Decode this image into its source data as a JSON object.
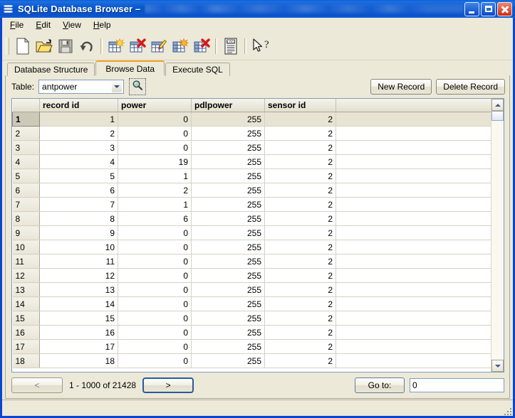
{
  "window": {
    "title": "SQLite Database Browser –",
    "title_icon": "database-stack-icon",
    "minimize_label": "Minimize",
    "maximize_label": "Maximize",
    "close_label": "Close"
  },
  "menu": {
    "items": [
      {
        "label": "File",
        "mnemonic": "F"
      },
      {
        "label": "Edit",
        "mnemonic": "E"
      },
      {
        "label": "View",
        "mnemonic": "V"
      },
      {
        "label": "Help",
        "mnemonic": "H"
      }
    ]
  },
  "toolbar": {
    "buttons": [
      {
        "icon": "new-database-icon",
        "label": "New Database"
      },
      {
        "icon": "open-database-icon",
        "label": "Open Database"
      },
      {
        "icon": "save-icon",
        "label": "Write Changes"
      },
      {
        "icon": "undo-icon",
        "label": "Revert Changes"
      },
      {
        "icon": "create-table-icon",
        "label": "Create Table"
      },
      {
        "icon": "delete-table-icon",
        "label": "Delete Table"
      },
      {
        "icon": "modify-table-icon",
        "label": "Modify Table"
      },
      {
        "icon": "create-index-icon",
        "label": "Create Index"
      },
      {
        "icon": "delete-index-icon",
        "label": "Delete Index"
      },
      {
        "icon": "log-icon",
        "label": "SQL Log"
      },
      {
        "icon": "help-cursor-icon",
        "label": "What's This?"
      }
    ]
  },
  "tabs": [
    {
      "label": "Database Structure",
      "active": false
    },
    {
      "label": "Browse Data",
      "active": true
    },
    {
      "label": "Execute SQL",
      "active": false
    }
  ],
  "browse": {
    "table_label": "Table:",
    "table_value": "antpower",
    "search_icon": "magnifier-icon",
    "new_record_label": "New Record",
    "delete_record_label": "Delete Record"
  },
  "grid": {
    "columns": [
      "record id",
      "power",
      "pdlpower",
      "sensor id"
    ],
    "selected_row": 1,
    "rows": [
      {
        "n": "1",
        "cells": [
          "1",
          "0",
          "255",
          "2"
        ]
      },
      {
        "n": "2",
        "cells": [
          "2",
          "0",
          "255",
          "2"
        ]
      },
      {
        "n": "3",
        "cells": [
          "3",
          "0",
          "255",
          "2"
        ]
      },
      {
        "n": "4",
        "cells": [
          "4",
          "19",
          "255",
          "2"
        ]
      },
      {
        "n": "5",
        "cells": [
          "5",
          "1",
          "255",
          "2"
        ]
      },
      {
        "n": "6",
        "cells": [
          "6",
          "2",
          "255",
          "2"
        ]
      },
      {
        "n": "7",
        "cells": [
          "7",
          "1",
          "255",
          "2"
        ]
      },
      {
        "n": "8",
        "cells": [
          "8",
          "6",
          "255",
          "2"
        ]
      },
      {
        "n": "9",
        "cells": [
          "9",
          "0",
          "255",
          "2"
        ]
      },
      {
        "n": "10",
        "cells": [
          "10",
          "0",
          "255",
          "2"
        ]
      },
      {
        "n": "11",
        "cells": [
          "11",
          "0",
          "255",
          "2"
        ]
      },
      {
        "n": "12",
        "cells": [
          "12",
          "0",
          "255",
          "2"
        ]
      },
      {
        "n": "13",
        "cells": [
          "13",
          "0",
          "255",
          "2"
        ]
      },
      {
        "n": "14",
        "cells": [
          "14",
          "0",
          "255",
          "2"
        ]
      },
      {
        "n": "15",
        "cells": [
          "15",
          "0",
          "255",
          "2"
        ]
      },
      {
        "n": "16",
        "cells": [
          "16",
          "0",
          "255",
          "2"
        ]
      },
      {
        "n": "17",
        "cells": [
          "17",
          "0",
          "255",
          "2"
        ]
      },
      {
        "n": "18",
        "cells": [
          "18",
          "0",
          "255",
          "2"
        ]
      }
    ]
  },
  "pagination": {
    "prev_label": "<",
    "prev_enabled": false,
    "next_label": ">",
    "next_enabled": true,
    "info": "1 - 1000 of 21428",
    "goto_label": "Go to:",
    "goto_value": "0"
  },
  "colors": {
    "titlebar_blue": "#0a53cb",
    "window_frame": "#0a46d2",
    "face": "#ece9d8",
    "active_tab_accent": "#f0a32a",
    "selection": "#e8e4d3",
    "field_border": "#7f9db9"
  }
}
